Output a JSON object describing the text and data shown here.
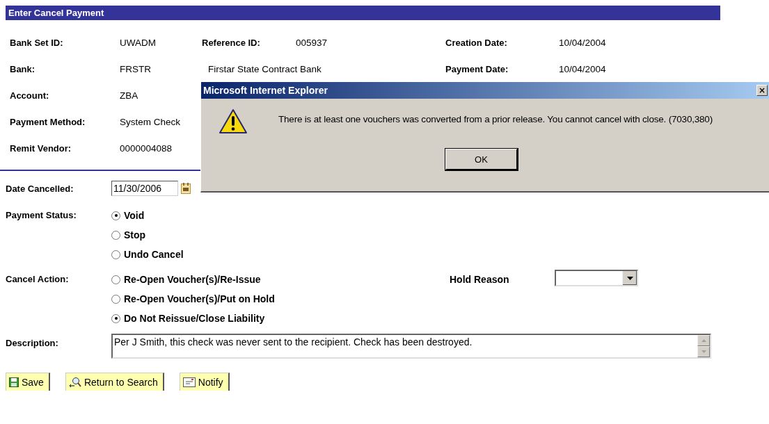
{
  "page_title": "Enter Cancel Payment",
  "header_rows": [
    {
      "items": [
        {
          "kind": "label",
          "text": "Bank Set ID:"
        },
        {
          "kind": "value",
          "text": "UWADM"
        },
        {
          "kind": "label",
          "text": "Reference ID:"
        },
        {
          "kind": "value",
          "text": "005937"
        },
        {
          "kind": "label",
          "text": "Creation Date:"
        },
        {
          "kind": "value",
          "text": "10/04/2004"
        }
      ]
    },
    {
      "items": [
        {
          "kind": "label",
          "text": "Bank:"
        },
        {
          "kind": "value",
          "text": "FRSTR"
        },
        {
          "kind": "description",
          "text": "Firstar State Contract Bank"
        },
        {
          "kind": "label",
          "text": "Payment Date:"
        },
        {
          "kind": "value",
          "text": "10/04/2004"
        }
      ]
    },
    {
      "items": [
        {
          "kind": "label",
          "text": "Account:"
        },
        {
          "kind": "value",
          "text": "ZBA"
        }
      ]
    },
    {
      "items": [
        {
          "kind": "label",
          "text": "Payment Method:"
        },
        {
          "kind": "value",
          "text": "System Check"
        }
      ]
    },
    {
      "items": [
        {
          "kind": "label",
          "text": "Remit Vendor:"
        },
        {
          "kind": "value",
          "text": "0000004088"
        }
      ]
    }
  ],
  "date_cancelled": {
    "label": "Date Cancelled:",
    "value": "11/30/2006"
  },
  "payment_status": {
    "label": "Payment Status:",
    "options": [
      {
        "label": "Void",
        "selected": true
      },
      {
        "label": "Stop",
        "selected": false
      },
      {
        "label": "Undo Cancel",
        "selected": false
      }
    ]
  },
  "cancel_action": {
    "label": "Cancel Action:",
    "options": [
      {
        "label": "Re-Open Voucher(s)/Re-Issue",
        "selected": false
      },
      {
        "label": "Re-Open Voucher(s)/Put on Hold",
        "selected": false
      },
      {
        "label": "Do Not Reissue/Close Liability",
        "selected": true
      }
    ]
  },
  "hold_reason": {
    "label": "Hold Reason"
  },
  "description": {
    "label": "Description:",
    "value": "Per J Smith, this check was never sent to the recipient. Check has been destroyed."
  },
  "buttons": [
    {
      "kind": "save",
      "label": "Save"
    },
    {
      "kind": "search",
      "label": "Return to Search"
    },
    {
      "kind": "notify",
      "label": "Notify"
    }
  ],
  "dialog": {
    "title": "Microsoft Internet Explorer",
    "close": "×",
    "message": "There is at least one vouchers was converted from a prior release.  You cannot cancel with close. (7030,380)",
    "button": "OK"
  }
}
